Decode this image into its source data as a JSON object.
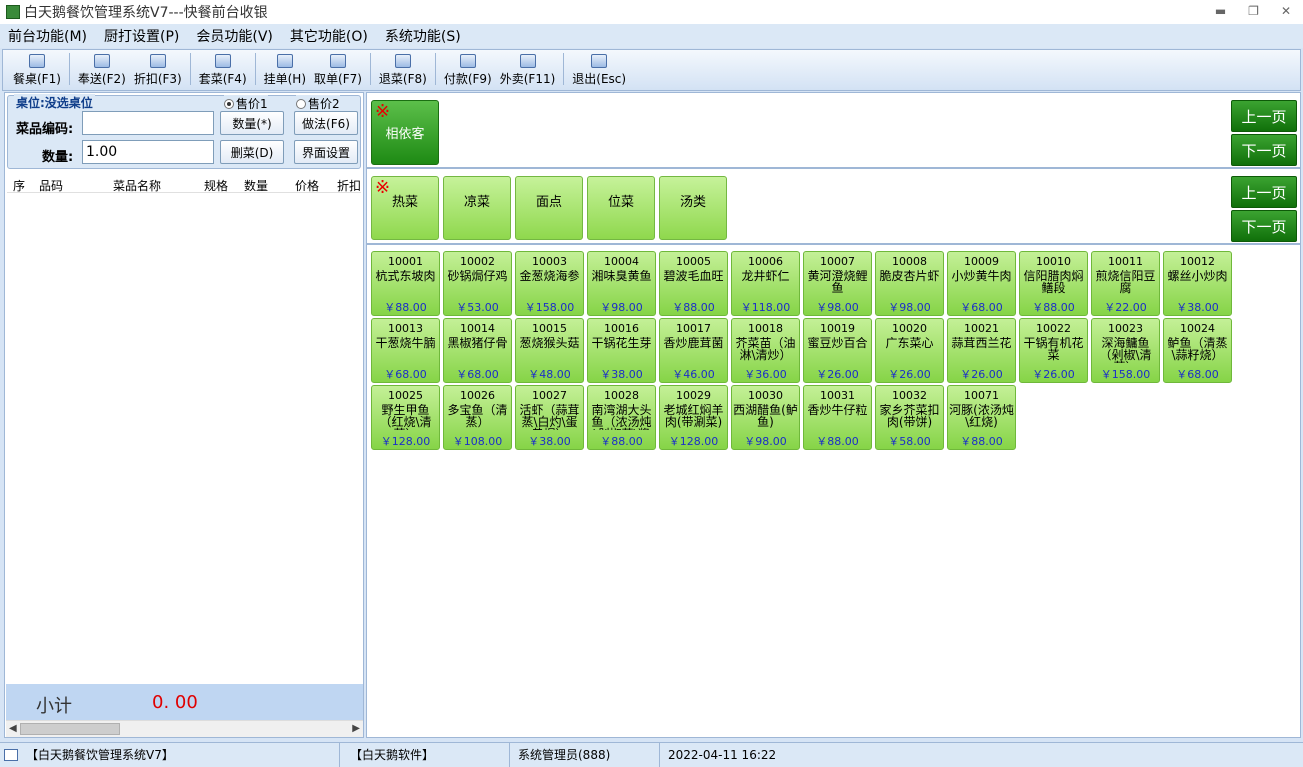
{
  "window": {
    "title": "白天鹅餐饮管理系统V7---快餐前台收银"
  },
  "menu": [
    "前台功能(M)",
    "厨打设置(P)",
    "会员功能(V)",
    "其它功能(O)",
    "系统功能(S)"
  ],
  "toolbar": [
    {
      "label": "餐桌(F1)",
      "icon": "table-icon"
    },
    {
      "label": "奉送(F2)",
      "icon": "gift-icon"
    },
    {
      "label": "折扣(F3)",
      "icon": "discount-icon"
    },
    {
      "label": "套菜(F4)",
      "icon": "set-meal-icon"
    },
    {
      "label": "挂单(H)",
      "icon": "hold-order-icon"
    },
    {
      "label": "取单(F7)",
      "icon": "retrieve-order-icon"
    },
    {
      "label": "退菜(F8)",
      "icon": "return-dish-icon"
    },
    {
      "label": "付款(F9)",
      "icon": "payment-icon"
    },
    {
      "label": "外卖(F11)",
      "icon": "takeout-icon"
    },
    {
      "label": "退出(Esc)",
      "icon": "exit-icon"
    }
  ],
  "order_panel": {
    "legend": "桌位:没选桌位",
    "price1": "售价1",
    "price2": "售价2",
    "code_label": "菜品编码:",
    "code_value": "",
    "qty_label": "数量:",
    "qty_value": "1.00",
    "btn_qty": "数量(*)",
    "btn_method": "做法(F6)",
    "btn_delete": "删菜(D)",
    "btn_settings": "界面设置",
    "columns": [
      "序",
      "品码",
      "菜品名称",
      "规格",
      "数量",
      "价格",
      "折扣"
    ],
    "subtotal_label": "小计",
    "subtotal_value": "0. 00"
  },
  "areas": [
    {
      "name": "相依客"
    }
  ],
  "categories": [
    {
      "name": "热菜"
    },
    {
      "name": "凉菜"
    },
    {
      "name": "面点"
    },
    {
      "name": "位菜"
    },
    {
      "name": "汤类"
    }
  ],
  "paging": {
    "prev": "上一页",
    "next": "下一页"
  },
  "dishes": [
    {
      "code": "10001",
      "name": "杭式东坡肉",
      "price": "￥88.00"
    },
    {
      "code": "10002",
      "name": "砂锅焗仔鸡",
      "price": "￥53.00"
    },
    {
      "code": "10003",
      "name": "金葱烧海参",
      "price": "￥158.00"
    },
    {
      "code": "10004",
      "name": "湘味臭黄鱼",
      "price": "￥98.00"
    },
    {
      "code": "10005",
      "name": "碧波毛血旺",
      "price": "￥88.00"
    },
    {
      "code": "10006",
      "name": "龙井虾仁",
      "price": "￥118.00"
    },
    {
      "code": "10007",
      "name": "黄河澄烧鲤鱼",
      "price": "￥98.00"
    },
    {
      "code": "10008",
      "name": "脆皮杏片虾",
      "price": "￥98.00"
    },
    {
      "code": "10009",
      "name": "小炒黄牛肉",
      "price": "￥68.00"
    },
    {
      "code": "10010",
      "name": "信阳腊肉焖鳝段",
      "price": "￥88.00"
    },
    {
      "code": "10011",
      "name": "煎烧信阳豆腐",
      "price": "￥22.00"
    },
    {
      "code": "10012",
      "name": "螺丝小炒肉",
      "price": "￥38.00"
    },
    {
      "code": "10013",
      "name": "干葱烧牛腩",
      "price": "￥68.00"
    },
    {
      "code": "10014",
      "name": "黑椒猪仔骨",
      "price": "￥68.00"
    },
    {
      "code": "10015",
      "name": "葱烧猴头菇",
      "price": "￥48.00"
    },
    {
      "code": "10016",
      "name": "干锅花生芽",
      "price": "￥38.00"
    },
    {
      "code": "10017",
      "name": "香炒鹿茸菌",
      "price": "￥46.00"
    },
    {
      "code": "10018",
      "name": "芥菜苗（油淋\\清炒）",
      "price": "￥36.00"
    },
    {
      "code": "10019",
      "name": "蜜豆炒百合",
      "price": "￥26.00"
    },
    {
      "code": "10020",
      "name": "广东菜心",
      "price": "￥26.00"
    },
    {
      "code": "10021",
      "name": "蒜茸西兰花",
      "price": "￥26.00"
    },
    {
      "code": "10022",
      "name": "干锅有机花菜",
      "price": "￥26.00"
    },
    {
      "code": "10023",
      "name": "深海鳙鱼（剁椒\\清蒸）",
      "price": "￥158.00"
    },
    {
      "code": "10024",
      "name": "鲈鱼（清蒸\\蒜籽烧）",
      "price": "￥68.00"
    },
    {
      "code": "10025",
      "name": "野生甲鱼（红烧\\清蒸）",
      "price": "￥128.00"
    },
    {
      "code": "10026",
      "name": "多宝鱼（清蒸）",
      "price": "￥108.00"
    },
    {
      "code": "10027",
      "name": "活虾（蒜茸蒸\\白灼\\蛋黄焗）",
      "price": "￥38.00"
    },
    {
      "code": "10028",
      "name": "南湾湖大头鱼（浓汤炖\\剁椒蒸\\酱烧）",
      "price": "￥88.00"
    },
    {
      "code": "10029",
      "name": "老城红焖羊肉(带涮菜)",
      "price": "￥128.00"
    },
    {
      "code": "10030",
      "name": "西湖醋鱼(鲈鱼)",
      "price": "￥98.00"
    },
    {
      "code": "10031",
      "name": "香炒牛仔粒",
      "price": "￥88.00"
    },
    {
      "code": "10032",
      "name": "家乡芥菜扣肉(带饼)",
      "price": "￥58.00"
    },
    {
      "code": "10071",
      "name": "河豚(浓汤炖\\红烧)",
      "price": "￥88.00"
    }
  ],
  "statusbar": [
    "【白天鹅餐饮管理系统V7】",
    "【白天鹅软件】",
    "系统管理员(888)",
    "2022-04-11 16:22"
  ]
}
